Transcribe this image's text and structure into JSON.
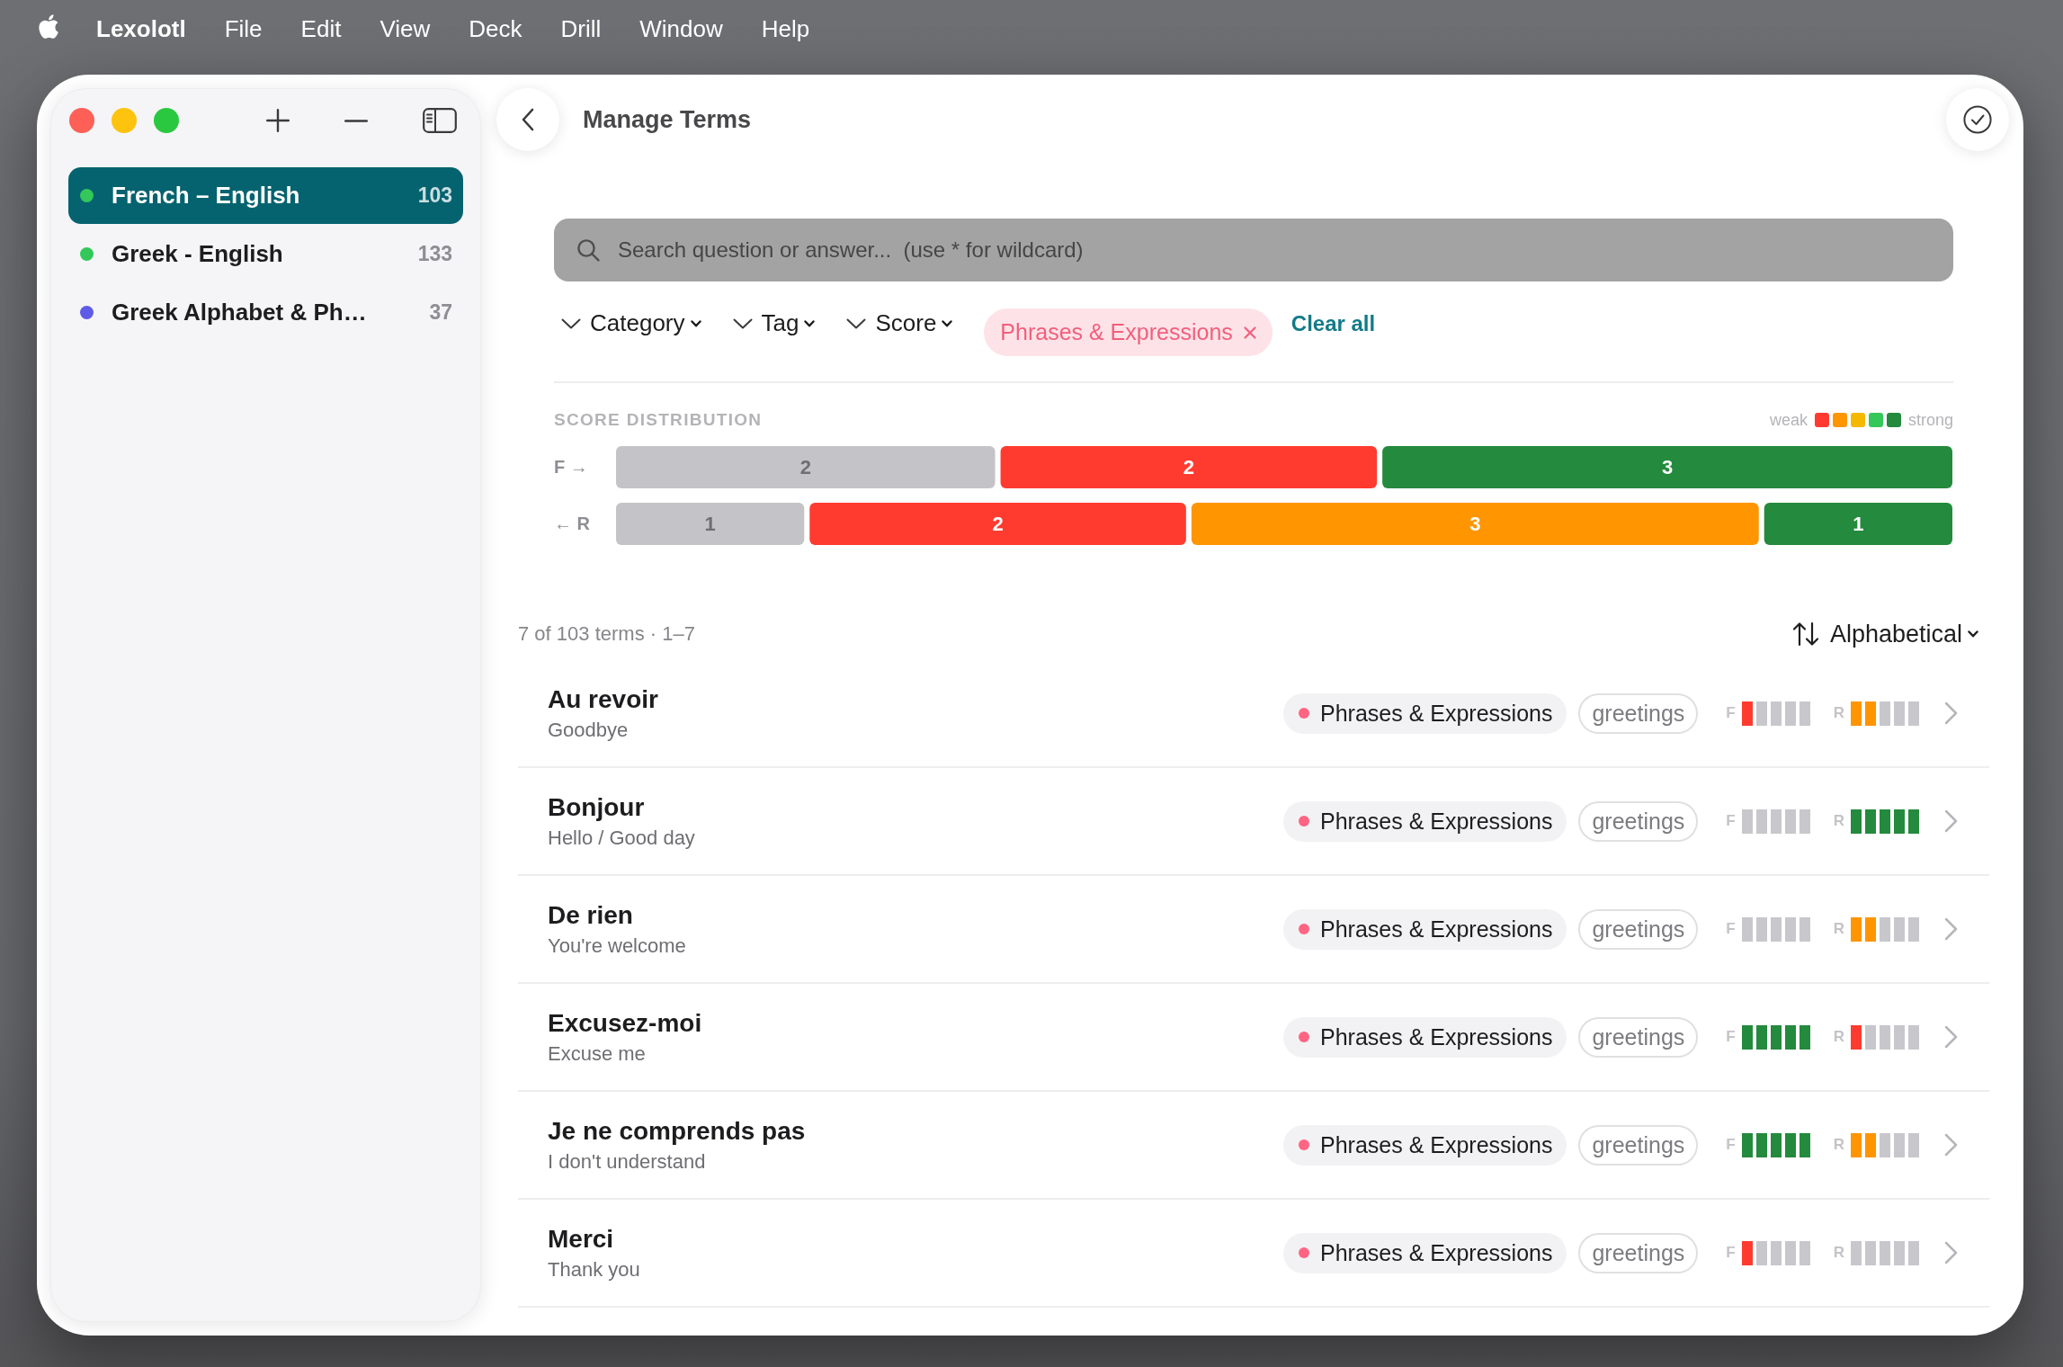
{
  "menu_bar": {
    "app_name": "Lexolotl",
    "items": [
      "File",
      "Edit",
      "View",
      "Deck",
      "Drill",
      "Window",
      "Help"
    ]
  },
  "sidebar": {
    "decks": [
      {
        "name": "French – English",
        "count": "103",
        "color": "#34c759",
        "selected": true
      },
      {
        "name": "Greek - English",
        "count": "133",
        "color": "#34c759",
        "selected": false
      },
      {
        "name": "Greek Alphabet & Ph…",
        "count": "37",
        "color": "#5e5ce6",
        "selected": false
      }
    ]
  },
  "header": {
    "title": "Manage Terms"
  },
  "search": {
    "placeholder": "Search question or answer...  (use * for wildcard)"
  },
  "filters": [
    {
      "label": "Category"
    },
    {
      "label": "Tag"
    },
    {
      "label": "Score"
    }
  ],
  "active_filters": [
    {
      "label": "Phrases & Expressions"
    }
  ],
  "clear_all": "Clear all",
  "score_distribution": {
    "legend": {
      "low_label": "weak",
      "high_label": "strong",
      "swatches": [
        {
          "color": "#ff3b30"
        },
        {
          "color": "#ff9500"
        },
        {
          "color": "#f5b800"
        },
        {
          "color": "#34c759"
        },
        {
          "color": "#248a3d"
        }
      ]
    },
    "chart_data": {
      "type": "other",
      "title": "SCORE DISTRIBUTION",
      "categories": [
        "F →",
        "← R"
      ],
      "series": [
        {
          "color": "#c4c4c8",
          "values": [
            2,
            1
          ]
        },
        {
          "color": "#ff3b30",
          "values": [
            2,
            2
          ]
        },
        {
          "color": "#ff9500",
          "values": [
            null,
            3
          ]
        },
        {
          "color": "#248a3d",
          "values": [
            3,
            1
          ]
        }
      ],
      "data_labels": true
    }
  },
  "list": {
    "summary": "7 of 103 terms · 1–7",
    "sort": "Alphabetical",
    "terms": [
      {
        "term": "Au revoir",
        "translation": "Goodbye",
        "category": {
          "name": "Phrases & Expressions",
          "color": "#ff6482"
        },
        "tag": "greetings",
        "scores": [
          {
            "label": "F",
            "level": 0.2
          },
          {
            "label": "R",
            "level": 0.4
          }
        ]
      },
      {
        "term": "Bonjour",
        "translation": "Hello / Good day",
        "category": {
          "name": "Phrases & Expressions",
          "color": "#ff6482"
        },
        "tag": "greetings",
        "scores": [
          {
            "label": "F",
            "level": 0
          },
          {
            "label": "R",
            "level": 1
          }
        ]
      },
      {
        "term": "De rien",
        "translation": "You're welcome",
        "category": {
          "name": "Phrases & Expressions",
          "color": "#ff6482"
        },
        "tag": "greetings",
        "scores": [
          {
            "label": "F",
            "level": 0
          },
          {
            "label": "R",
            "level": 0.4
          }
        ]
      },
      {
        "term": "Excusez-moi",
        "translation": "Excuse me",
        "category": {
          "name": "Phrases & Expressions",
          "color": "#ff6482"
        },
        "tag": "greetings",
        "scores": [
          {
            "label": "F",
            "level": 1
          },
          {
            "label": "R",
            "level": 0.2
          }
        ]
      },
      {
        "term": "Je ne comprends pas",
        "translation": "I don't understand",
        "category": {
          "name": "Phrases & Expressions",
          "color": "#ff6482"
        },
        "tag": "greetings",
        "scores": [
          {
            "label": "F",
            "level": 1
          },
          {
            "label": "R",
            "level": 0.4
          }
        ]
      },
      {
        "term": "Merci",
        "translation": "Thank you",
        "category": {
          "name": "Phrases & Expressions",
          "color": "#ff6482"
        },
        "tag": "greetings",
        "scores": [
          {
            "label": "F",
            "level": 0.2
          },
          {
            "label": "R",
            "level": 0
          }
        ]
      }
    ]
  }
}
